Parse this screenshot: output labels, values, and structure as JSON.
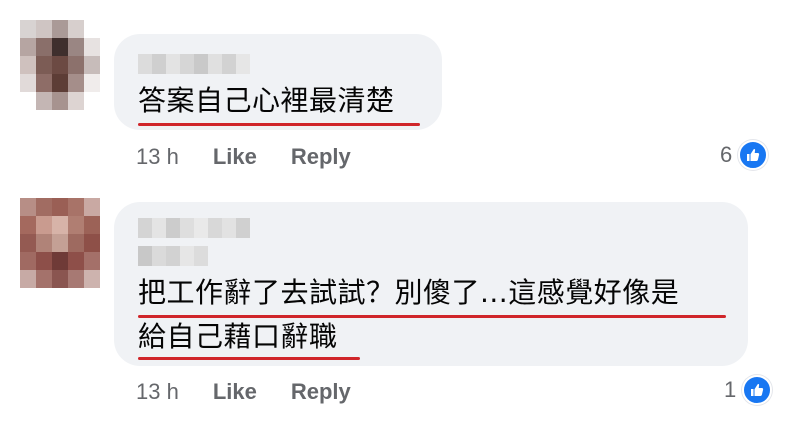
{
  "comments": [
    {
      "text_lines": [
        "答案自己心裡最清楚"
      ],
      "time": "13 h",
      "like_label": "Like",
      "reply_label": "Reply",
      "reaction_count": "6"
    },
    {
      "text_lines": [
        "把工作辭了去試試？別傻了...這感覺好像是",
        "給自己藉口辭職"
      ],
      "time": "13 h",
      "like_label": "Like",
      "reply_label": "Reply",
      "reaction_count": "1"
    }
  ],
  "colors": {
    "bubble": "#f0f2f5",
    "underline": "#d0262a",
    "like_blue": "#1877f2",
    "meta_gray": "#65676b"
  },
  "icons": {
    "avatar": "pixelated-avatar",
    "name": "pixelated-name",
    "like": "thumbs-up-icon"
  }
}
